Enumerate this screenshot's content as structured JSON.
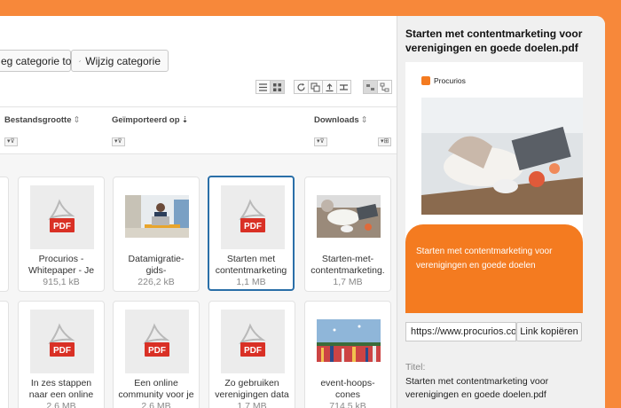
{
  "toolbar": {
    "add_category_label": "eg categorie toe",
    "edit_category_label": "Wijzig categorie"
  },
  "columns": {
    "file_size": "Bestandsgrootte",
    "imported_on": "Geïmporteerd op",
    "downloads": "Downloads"
  },
  "files": [
    {
      "name_line1": "Procurios -",
      "name_line2": "Whitepaper - Je",
      "size": "915,1 kB",
      "type": "pdf"
    },
    {
      "name_line1": "Datamigratie-",
      "name_line2": "gids-",
      "size": "226,2 kB",
      "type": "photo-office"
    },
    {
      "name_line1": "Starten met",
      "name_line2": "contentmarketing",
      "size": "1,1 MB",
      "type": "pdf",
      "selected": true
    },
    {
      "name_line1": "Starten-met-",
      "name_line2": "contentmarketing.",
      "size": "1,7 MB",
      "type": "photo-desk"
    },
    {
      "name_line1": "In zes stappen",
      "name_line2": "naar een online",
      "size": "2,6 MB",
      "type": "pdf"
    },
    {
      "name_line1": "Een online",
      "name_line2": "community voor je",
      "size": "2,6 MB",
      "type": "pdf"
    },
    {
      "name_line1": "Zo gebruiken",
      "name_line2": "verenigingen data",
      "size": "1,7 MB",
      "type": "pdf"
    },
    {
      "name_line1": "event-hoops-",
      "name_line2": "cones",
      "size": "714,5 kB",
      "type": "photo-crowd"
    }
  ],
  "icons": {
    "pdf_label": "PDF"
  },
  "panel": {
    "title": "Starten met contentmarketing voor verenigingen en goede doelen.pdf",
    "preview": {
      "logo_text": "Procurios",
      "headline": "Starten met contentmarketing voor verenigingen en goede doelen"
    },
    "url_value": "https://www.procurios.con",
    "copy_label": "Link kopiëren",
    "title_label": "Titel:",
    "title_value": "Starten met contentmarketing voor verenigingen en goede doelen.pdf"
  },
  "colors": {
    "accent": "#f47b20",
    "selection": "#2a6fa8",
    "pdf_red": "#d93025"
  }
}
